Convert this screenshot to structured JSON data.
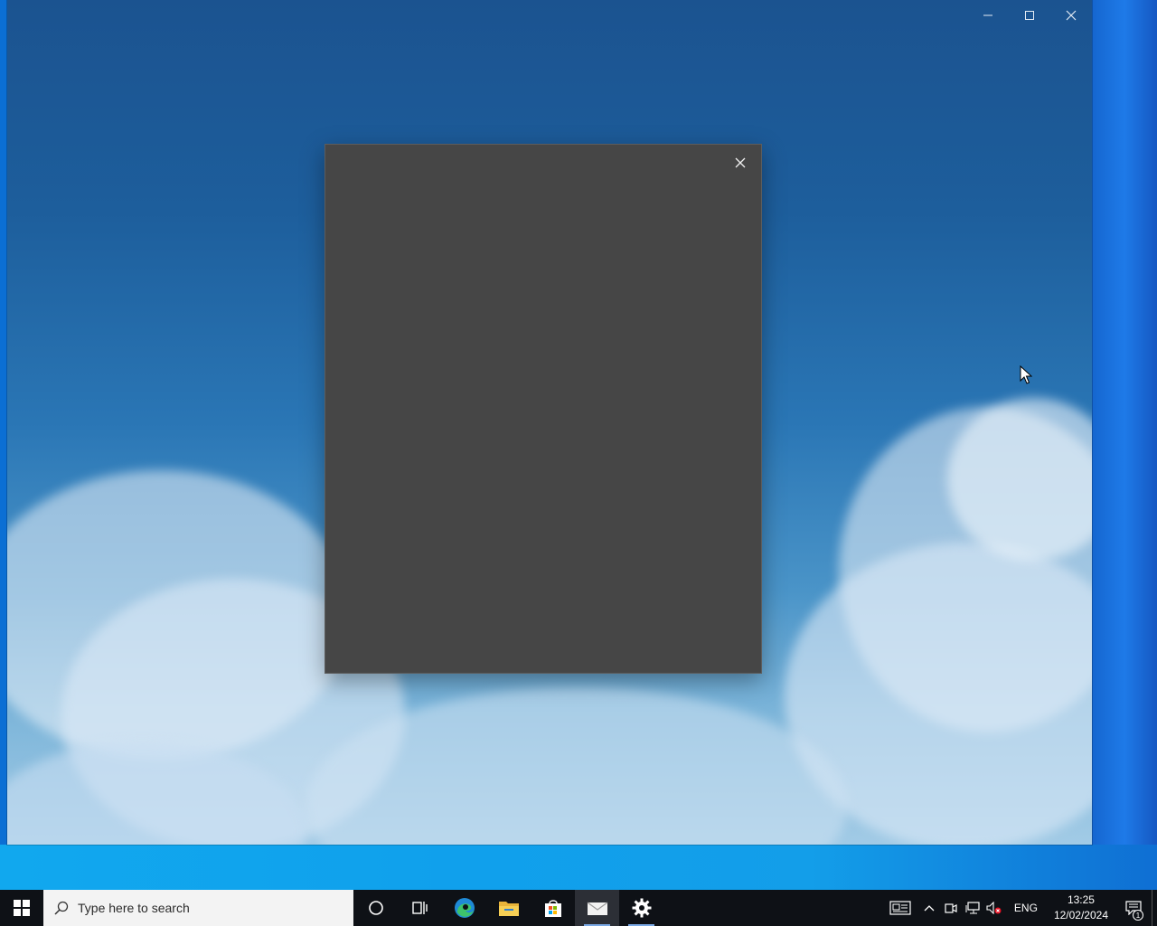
{
  "app_window": {
    "controls": {
      "minimize": "—",
      "maximize": "☐",
      "close": "✕"
    }
  },
  "dialog": {
    "background": "#464646",
    "close_icon": "close-icon"
  },
  "taskbar": {
    "search": {
      "placeholder": "Type here to search"
    },
    "pinned": [
      {
        "name": "cortana",
        "icon": "cortana-circle-icon"
      },
      {
        "name": "task-view",
        "icon": "task-view-icon"
      },
      {
        "name": "edge",
        "icon": "edge-icon"
      },
      {
        "name": "file-explorer",
        "icon": "folder-icon"
      },
      {
        "name": "store",
        "icon": "store-bag-icon"
      },
      {
        "name": "mail",
        "icon": "mail-icon",
        "active": true
      },
      {
        "name": "settings",
        "icon": "gear-icon",
        "running": true
      }
    ],
    "tray": {
      "language": "ENG",
      "time": "13:25",
      "date": "12/02/2024",
      "notifications": "1"
    }
  },
  "colors": {
    "taskbar": "#0e1116",
    "dialog": "#464646",
    "accent": "#7aa9e6"
  }
}
